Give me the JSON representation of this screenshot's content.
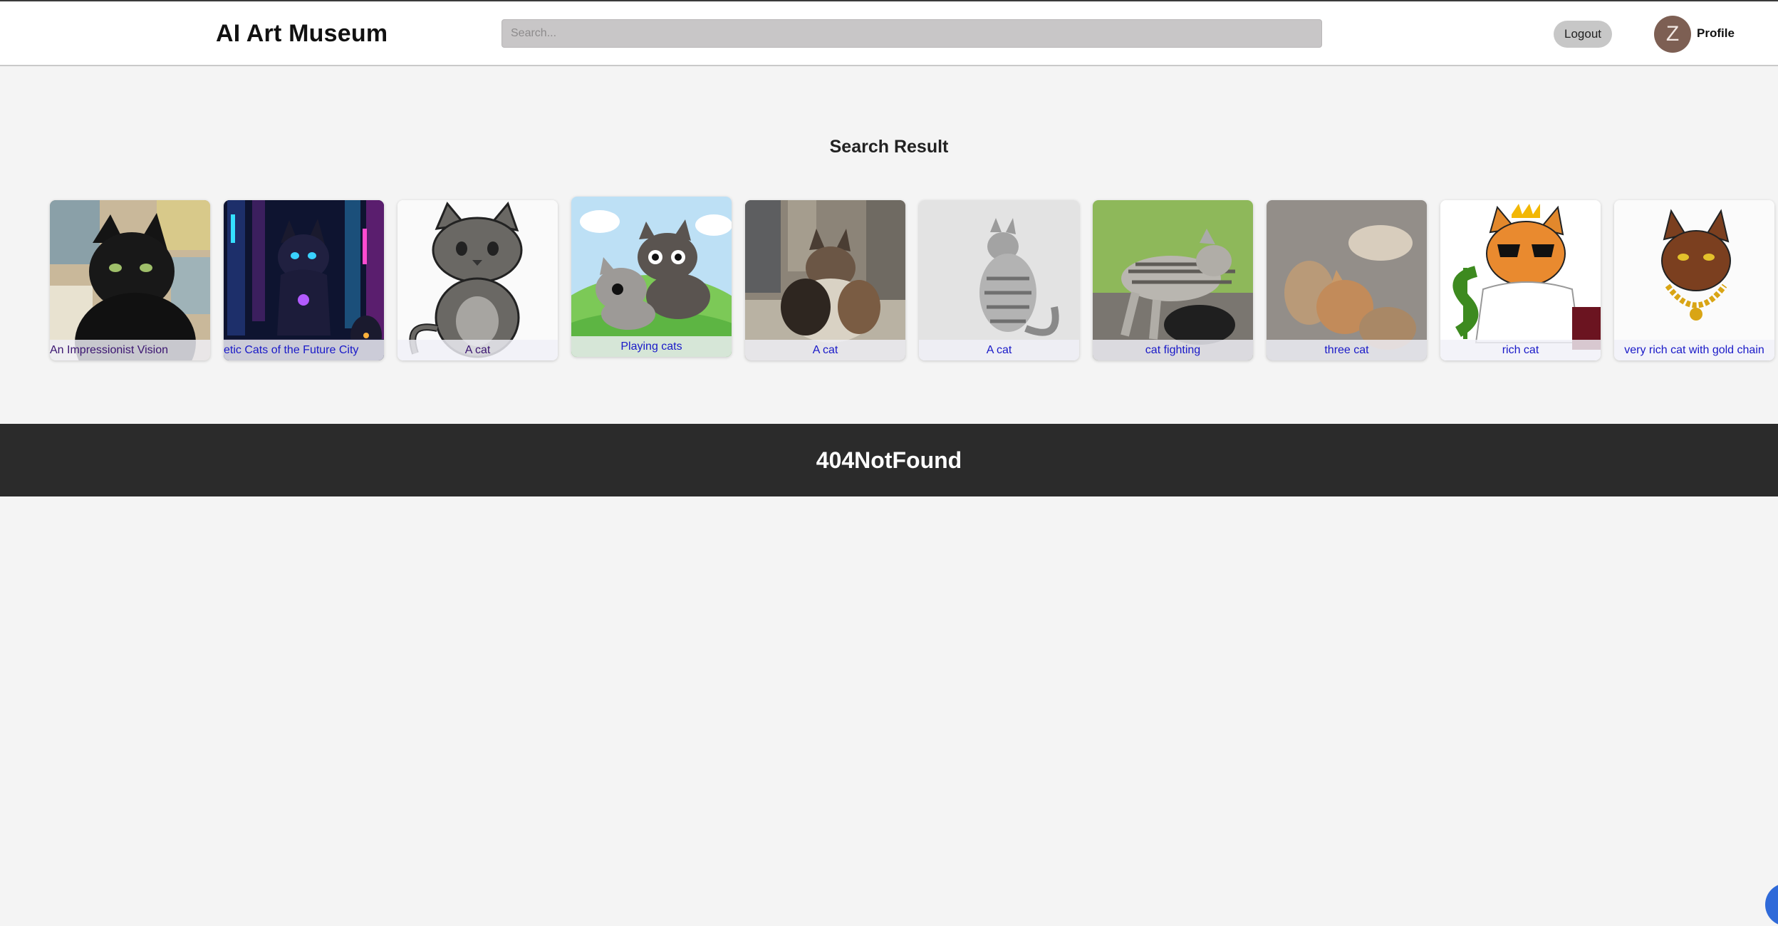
{
  "app": {
    "title": "AI Art Museum"
  },
  "header": {
    "search_placeholder": "Search...",
    "logout_label": "Logout",
    "avatar_initial": "Z",
    "profile_label": "Profile"
  },
  "main": {
    "title": "Search Result",
    "results": [
      {
        "caption": "An Impressionist Vision",
        "image": "black cat impressionist painting"
      },
      {
        "caption": "etic Cats of the Future City",
        "image": "cybernetic cats in neon city"
      },
      {
        "caption": "A cat",
        "image": "cartoon grey cat"
      },
      {
        "caption": "Playing cats",
        "image": "cartoon cats playing on grass"
      },
      {
        "caption": "A cat",
        "image": "painted fluffy cat"
      },
      {
        "caption": "A cat",
        "image": "faded photo of tabby cat"
      },
      {
        "caption": "cat fighting",
        "image": "photo of cats fighting on grass"
      },
      {
        "caption": "three cat",
        "image": "photo of three cats playing"
      },
      {
        "caption": "rich cat",
        "image": "cartoon orange cat with crown and dollar sign"
      },
      {
        "caption": "very rich cat with gold chain",
        "image": "cartoon brown cat with gold chain"
      }
    ]
  },
  "footer": {
    "text": "404NotFound"
  },
  "colors": {
    "caption_text": "#1919c8",
    "footer_bg": "#2b2b2b",
    "search_bg": "#c8c6c7",
    "avatar_bg": "#7d5f53"
  }
}
